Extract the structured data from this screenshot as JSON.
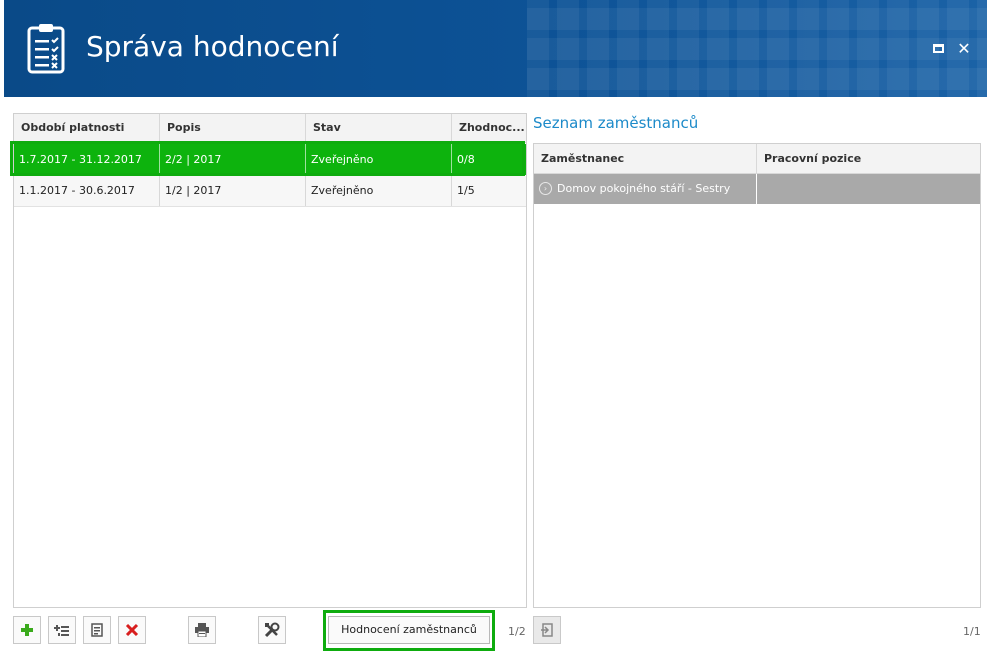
{
  "header": {
    "title": "Správa hodnocení",
    "icons": [
      "clipboard-checklist-icon",
      "maximize-icon",
      "close-icon"
    ],
    "close_glyph": "✕"
  },
  "left_grid": {
    "columns": [
      "Období platnosti",
      "Popis",
      "Stav",
      "Zhodnoc..."
    ],
    "rows": [
      {
        "period": "1.7.2017 - 31.12.2017",
        "desc": "2/2 | 2017",
        "status": "Zveřejněno",
        "eval": "0/8"
      },
      {
        "period": "1.1.2017 - 30.6.2017",
        "desc": "1/2 | 2017",
        "status": "Zveřejněno",
        "eval": "1/5"
      }
    ],
    "selected_color": "#0db30d"
  },
  "right_section": {
    "title": "Seznam zaměstnanců",
    "columns": [
      "Zaměstnanec",
      "Pracovní pozice"
    ],
    "rows": [
      {
        "employee": "Domov pokojného stáří - Sestry",
        "position": ""
      }
    ],
    "pager": "1/1"
  },
  "toolbar": {
    "buttons": [
      "add-icon",
      "add-sub-icon",
      "edit-icon",
      "delete-icon",
      "print-icon",
      "tools-icon"
    ],
    "eval_button_label": "Hodnocení zaměstnanců",
    "pager": "1/2",
    "export_icon": "export-icon"
  },
  "colors": {
    "header_bg": "#0b4f8f",
    "accent_green": "#0eac0e",
    "link_blue": "#1c8ac9"
  }
}
